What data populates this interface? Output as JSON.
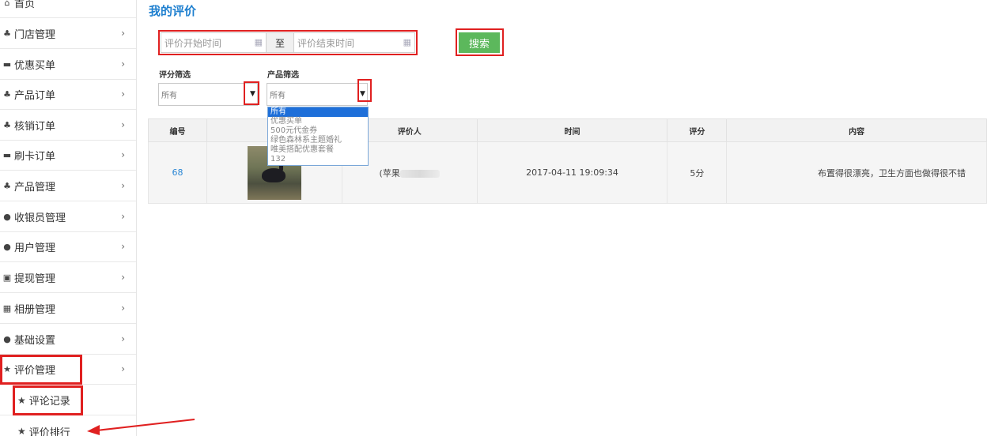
{
  "sidebar": {
    "home": "首页",
    "items": [
      {
        "label": "门店管理",
        "icon": "sitemap-icon"
      },
      {
        "label": "优惠买单",
        "icon": "briefcase-icon"
      },
      {
        "label": "产品订单",
        "icon": "sitemap-icon"
      },
      {
        "label": "核销订单",
        "icon": "sitemap-icon"
      },
      {
        "label": "刷卡订单",
        "icon": "briefcase-icon"
      },
      {
        "label": "产品管理",
        "icon": "sitemap-icon"
      },
      {
        "label": "收银员管理",
        "icon": "user-icon"
      },
      {
        "label": "用户管理",
        "icon": "user-icon"
      },
      {
        "label": "提现管理",
        "icon": "money-icon"
      },
      {
        "label": "相册管理",
        "icon": "grid-icon"
      },
      {
        "label": "基础设置",
        "icon": "user-icon"
      },
      {
        "label": "评价管理",
        "icon": "star-icon"
      }
    ],
    "sub_items": [
      {
        "label": "评论记录",
        "icon": "star-icon"
      },
      {
        "label": "评价排行",
        "icon": "star-icon"
      }
    ]
  },
  "main": {
    "title": "我的评价",
    "date_start_placeholder": "评价开始时间",
    "date_sep": "至",
    "date_end_placeholder": "评价结束时间",
    "search_label": "搜索",
    "rating_filter_label": "评分筛选",
    "rating_filter_value": "所有",
    "product_filter_label": "产品筛选",
    "product_filter_value": "所有",
    "product_options": [
      "所有",
      "优惠买单",
      "500元代金券",
      "绿色森林系主题婚礼",
      "唯美搭配优惠套餐",
      "132"
    ]
  },
  "table": {
    "headers": [
      "编号",
      "",
      "评价人",
      "时间",
      "评分",
      "内容"
    ],
    "rows": [
      {
        "id": "68",
        "reviewer": "(苹果",
        "time": "2017-04-11 19:09:34",
        "score": "5分",
        "content": "布置得很漂亮，卫生方面也做得很不错"
      }
    ]
  },
  "colors": {
    "accent": "#1e7fcf",
    "search_button": "#5cb85c",
    "annotation": "#e02020",
    "dropdown_selected": "#1e6fd9"
  }
}
